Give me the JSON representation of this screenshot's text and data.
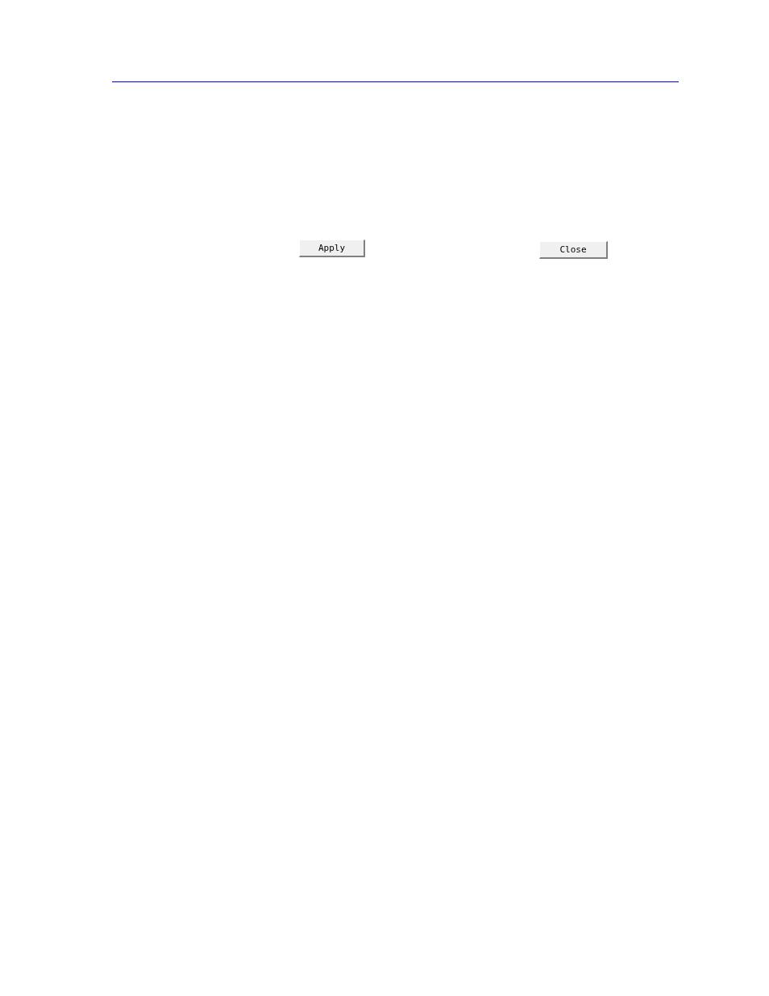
{
  "buttons": [
    {
      "label": "Apply"
    },
    {
      "label": "Close"
    }
  ]
}
